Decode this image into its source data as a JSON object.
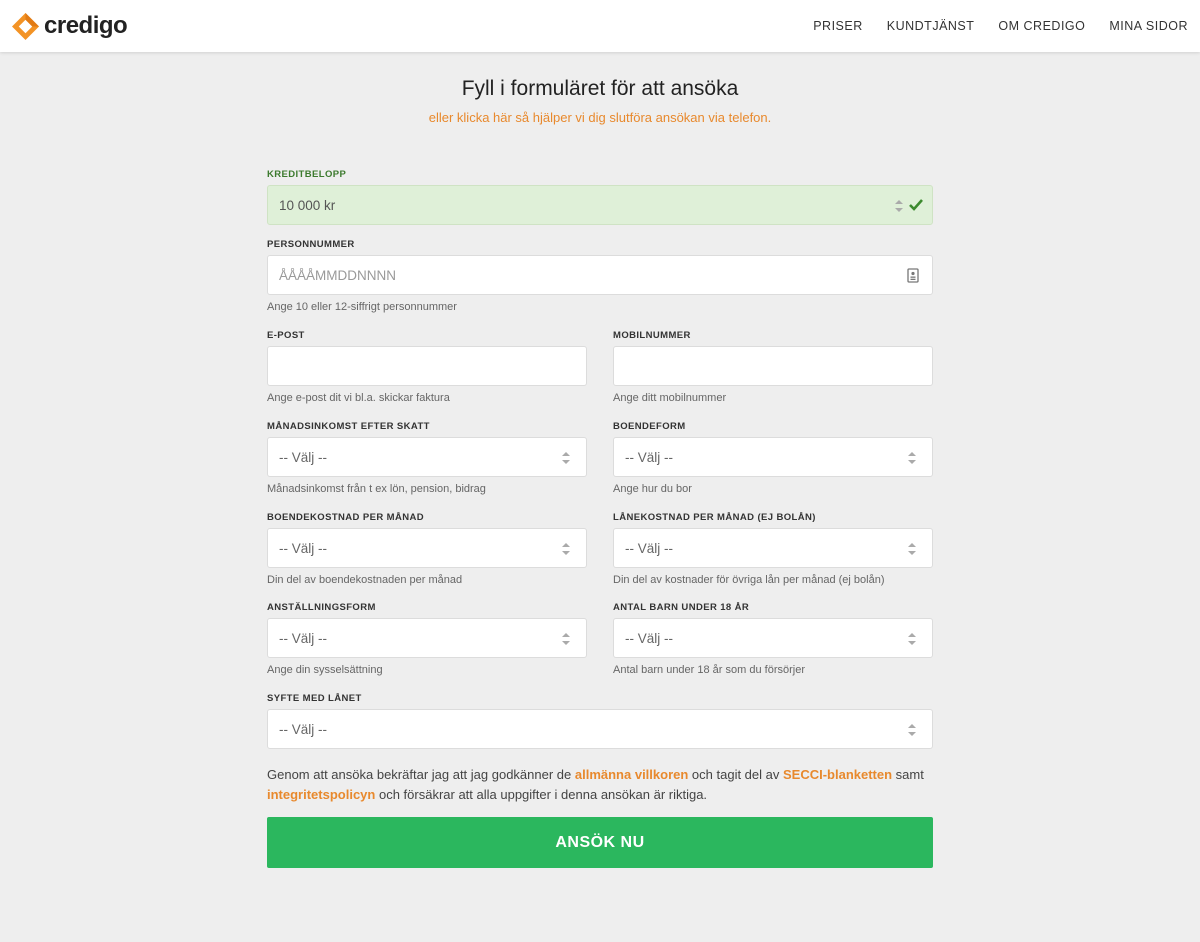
{
  "header": {
    "logo_text": "credigo",
    "nav": [
      "PRISER",
      "KUNDTJÄNST",
      "OM CREDIGO",
      "MINA SIDOR"
    ]
  },
  "page": {
    "title": "Fyll i formuläret för att ansöka",
    "subtitle": "eller klicka här så hjälper vi dig slutföra ansökan via telefon."
  },
  "form": {
    "amount": {
      "label": "KREDITBELOPP",
      "value": "10 000 kr"
    },
    "ssn": {
      "label": "PERSONNUMMER",
      "placeholder": "ÅÅÅÅMMDDNNNN",
      "hint": "Ange 10 eller 12-siffrigt personnummer"
    },
    "email": {
      "label": "E-POST",
      "value": "",
      "hint": "Ange e-post dit vi bl.a. skickar faktura"
    },
    "mobile": {
      "label": "MOBILNUMMER",
      "value": "",
      "hint": "Ange ditt mobilnummer"
    },
    "income": {
      "label": "MÅNADSINKOMST EFTER SKATT",
      "value": "-- Välj --",
      "hint": "Månadsinkomst från t ex lön, pension, bidrag"
    },
    "housing": {
      "label": "BOENDEFORM",
      "value": "-- Välj --",
      "hint": "Ange hur du bor"
    },
    "housing_cost": {
      "label": "BOENDEKOSTNAD PER MÅNAD",
      "value": "-- Välj --",
      "hint": "Din del av boendekostnaden per månad"
    },
    "loan_cost": {
      "label": "LÅNEKOSTNAD PER MÅNAD (EJ BOLÅN)",
      "value": "-- Välj --",
      "hint": "Din del av kostnader för övriga lån per månad (ej bolån)"
    },
    "employment": {
      "label": "ANSTÄLLNINGSFORM",
      "value": "-- Välj --",
      "hint": "Ange din sysselsättning"
    },
    "children": {
      "label": "ANTAL BARN UNDER 18 ÅR",
      "value": "-- Välj --",
      "hint": "Antal barn under 18 år som du försörjer"
    },
    "purpose": {
      "label": "SYFTE MED LÅNET",
      "value": "-- Välj --"
    }
  },
  "terms": {
    "t1": "Genom att ansöka bekräftar jag att jag godkänner de ",
    "link1": "allmänna villkoren",
    "t2": " och tagit del av ",
    "link2": "SECCI-blanketten",
    "t3": " samt ",
    "link3": "integritetspolicyn",
    "t4": " och försäkrar att alla uppgifter i denna ansökan är riktiga."
  },
  "submit_label": "ANSÖK NU",
  "colors": {
    "accent": "#e8892d",
    "success": "#2bb75e",
    "valid_bg": "#dff0d8"
  }
}
